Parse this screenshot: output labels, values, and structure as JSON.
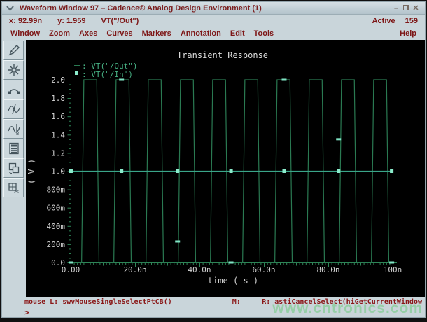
{
  "titlebar": {
    "title": "Waveform Window 97 – Cadence® Analog Design Environment (1)",
    "minimize_glyph": "–",
    "close_glyph": "✕"
  },
  "infobar": {
    "x_label": "x:",
    "x_value": "92.99n",
    "y_label": "y:",
    "y_value": "1.959",
    "trace_expr": "VT(\"/Out\")",
    "active_label": "Active",
    "active_count": "159"
  },
  "menu": {
    "items": [
      "Window",
      "Zoom",
      "Axes",
      "Curves",
      "Markers",
      "Annotation",
      "Edit",
      "Tools"
    ],
    "help_label": "Help"
  },
  "toolbar": {
    "icons": [
      "pen",
      "zoom-star",
      "arc",
      "marker-a",
      "marker-b",
      "calculator",
      "copy-window",
      "cut-window"
    ]
  },
  "chart_data": {
    "type": "line",
    "title": "Transient Response",
    "xlabel": "time ( s )",
    "ylabel": "( V )",
    "xlim": [
      0,
      100
    ],
    "ylim": [
      0,
      2
    ],
    "x_unit": "ns",
    "grid": false,
    "legend_position": "top-left",
    "x_minor_step": 1,
    "x_ticks": [
      {
        "t": 0,
        "label": "0.00"
      },
      {
        "t": 20,
        "label": "20.0n"
      },
      {
        "t": 40,
        "label": "40.0n"
      },
      {
        "t": 60,
        "label": "60.0n"
      },
      {
        "t": 80,
        "label": "80.0n"
      },
      {
        "t": 100,
        "label": "100n"
      }
    ],
    "y_ticks": [
      {
        "v": 0,
        "label": "0.0"
      },
      {
        "v": 0.2,
        "label": "200m"
      },
      {
        "v": 0.4,
        "label": "400m"
      },
      {
        "v": 0.6,
        "label": "600m"
      },
      {
        "v": 0.8,
        "label": "800m"
      },
      {
        "v": 1.0,
        "label": "1.0"
      },
      {
        "v": 1.2,
        "label": "1.2"
      },
      {
        "v": 1.4,
        "label": "1.4"
      },
      {
        "v": 1.6,
        "label": "1.6"
      },
      {
        "v": 1.8,
        "label": "1.8"
      },
      {
        "v": 2.0,
        "label": "2.0"
      }
    ],
    "colors": {
      "background": "#000000",
      "axis": "#2e8557",
      "tick_label": "#d4d4d4",
      "title": "#dcdcdc",
      "legend_text": "#46b083"
    },
    "series": [
      {
        "name": "VT(\"/Out\")",
        "symbol": "dash",
        "color": "#2a7a52",
        "marker_color": "#7fe4c4",
        "points": [
          [
            0,
            0
          ],
          [
            3.4,
            0
          ],
          [
            4.1,
            2
          ],
          [
            8.1,
            2
          ],
          [
            8.8,
            0
          ],
          [
            13.4,
            0
          ],
          [
            14.1,
            2
          ],
          [
            18.1,
            2
          ],
          [
            18.8,
            0
          ],
          [
            23.4,
            0
          ],
          [
            24.1,
            2
          ],
          [
            28.1,
            2
          ],
          [
            28.8,
            0
          ],
          [
            33.4,
            0
          ],
          [
            34.1,
            2
          ],
          [
            38.1,
            2
          ],
          [
            38.8,
            0
          ],
          [
            43.4,
            0
          ],
          [
            44.1,
            2
          ],
          [
            48.1,
            2
          ],
          [
            48.8,
            0
          ],
          [
            53.4,
            0
          ],
          [
            54.1,
            2
          ],
          [
            58.1,
            2
          ],
          [
            58.8,
            0
          ],
          [
            63.4,
            0
          ],
          [
            64.1,
            2
          ],
          [
            68.1,
            2
          ],
          [
            68.8,
            0
          ],
          [
            73.4,
            0
          ],
          [
            74.1,
            2
          ],
          [
            78.1,
            2
          ],
          [
            78.8,
            0
          ],
          [
            83.4,
            0
          ],
          [
            84.1,
            2
          ],
          [
            88.1,
            2
          ],
          [
            88.8,
            0
          ],
          [
            93.4,
            0
          ],
          [
            94.1,
            2
          ],
          [
            98.1,
            2
          ],
          [
            98.8,
            0
          ],
          [
            100,
            0
          ]
        ],
        "markers": [
          [
            0.1,
            0
          ],
          [
            15.8,
            2
          ],
          [
            33.2,
            0.23
          ],
          [
            49.8,
            0
          ],
          [
            66.3,
            2
          ],
          [
            83.2,
            1.35
          ],
          [
            99.7,
            0
          ]
        ]
      },
      {
        "name": "VT(\"/In\")",
        "symbol": "square",
        "color": "#3aa589",
        "marker_color": "#8ceccc",
        "points": [
          [
            0,
            1
          ],
          [
            100,
            1
          ]
        ],
        "markers": [
          [
            0.1,
            1
          ],
          [
            15.8,
            1
          ],
          [
            33.2,
            1
          ],
          [
            49.8,
            1
          ],
          [
            66.3,
            1
          ],
          [
            83.2,
            1
          ],
          [
            99.7,
            1
          ]
        ]
      }
    ]
  },
  "status": {
    "mouse_label": "mouse L:",
    "mouse_value": "swvMouseSingleSelectPtCB()",
    "m_label": "M:",
    "right_text": "R: astiCancelSelect(hiGetCurrentWindow",
    "prompt": ">"
  },
  "watermark": {
    "text": "www.cntronics.com"
  }
}
